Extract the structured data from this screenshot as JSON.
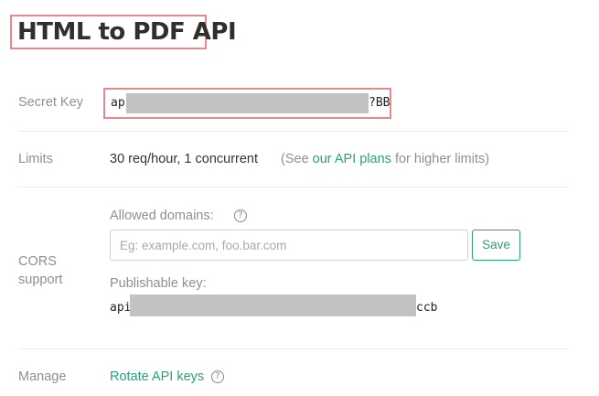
{
  "page": {
    "title": "HTML to PDF API"
  },
  "secret_key": {
    "label": "Secret Key",
    "prefix": "ap",
    "suffix": "?BB"
  },
  "limits": {
    "label": "Limits",
    "value": "30 req/hour, 1 concurrent",
    "note_open": "(See ",
    "note_link": "our API plans",
    "note_close": " for higher limits)"
  },
  "cors": {
    "label_line1": "CORS",
    "label_line2": "support",
    "allowed_domains_label": "Allowed domains:",
    "help_glyph": "?",
    "input_value": "",
    "input_placeholder": "Eg: example.com, foo.bar.com",
    "save_label": "Save",
    "publishable_label": "Publishable key:",
    "publishable_prefix": "api",
    "publishable_suffix": "ccb"
  },
  "manage": {
    "label": "Manage",
    "rotate_label": "Rotate API keys",
    "help_glyph": "?"
  },
  "colors": {
    "accent": "#2aa07c",
    "highlight_border": "#e8878c",
    "mask": "#c2c2c2"
  },
  "icons": [
    "help-circle-icon"
  ]
}
